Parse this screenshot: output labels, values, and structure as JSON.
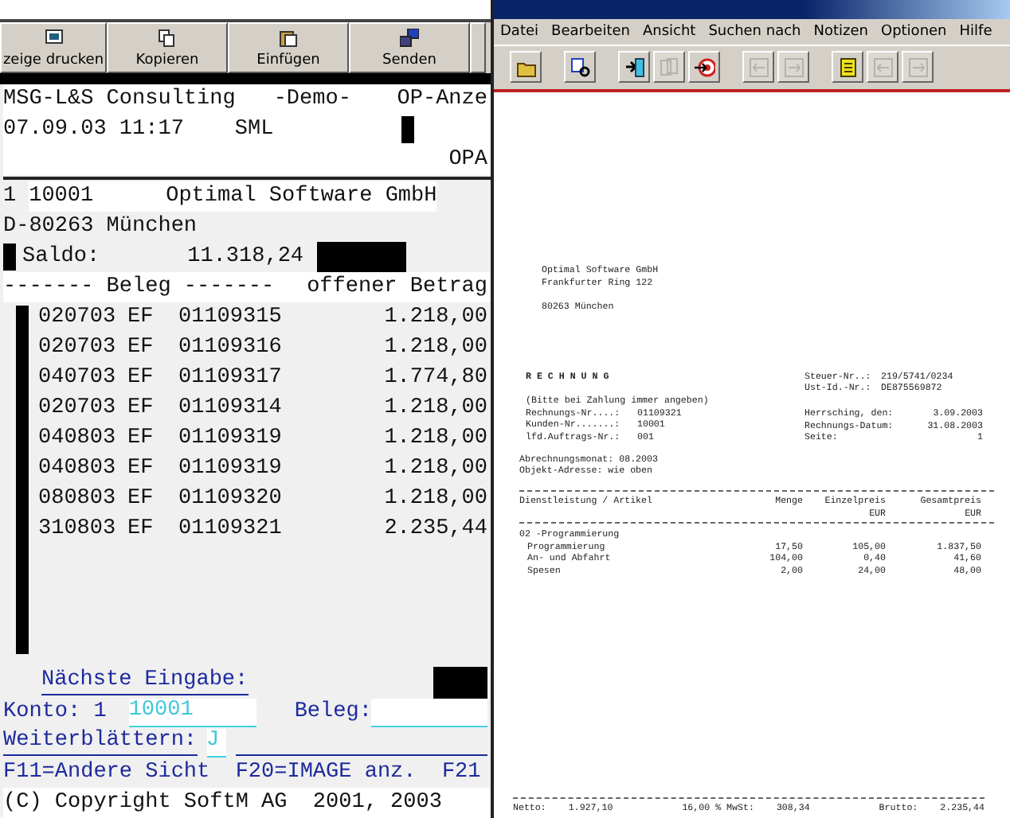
{
  "terminal_window": {
    "toolbar": [
      {
        "label": "zeige drucken",
        "kind": "print"
      },
      {
        "label": "Kopieren",
        "kind": "copy"
      },
      {
        "label": "Einfügen",
        "kind": "paste"
      },
      {
        "label": "Senden",
        "kind": "send"
      }
    ],
    "company": "MSG-L&S Consulting",
    "mode": "-Demo-",
    "screen_title": "OP-Anze",
    "datetime": "07.09.03 11:17",
    "user": "SML",
    "program": "OPA",
    "account_line": {
      "number": "1",
      "account": "10001",
      "name": "Optimal Software GmbH"
    },
    "city": "D-80263 München",
    "saldo_label": "Saldo:",
    "saldo": "11.318,24",
    "list_header": {
      "beleg": "------- Beleg -------",
      "betrag": "offener Betrag"
    },
    "rows": [
      {
        "date": "020703",
        "type": "EF",
        "beleg": "01109315",
        "amount": "1.218,00"
      },
      {
        "date": "020703",
        "type": "EF",
        "beleg": "01109316",
        "amount": "1.218,00"
      },
      {
        "date": "040703",
        "type": "EF",
        "beleg": "01109317",
        "amount": "1.774,80"
      },
      {
        "date": "020703",
        "type": "EF",
        "beleg": "01109314",
        "amount": "1.218,00"
      },
      {
        "date": "040803",
        "type": "EF",
        "beleg": "01109319",
        "amount": "1.218,00"
      },
      {
        "date": "040803",
        "type": "EF",
        "beleg": "01109319",
        "amount": "1.218,00"
      },
      {
        "date": "080803",
        "type": "EF",
        "beleg": "01109320",
        "amount": "1.218,00"
      },
      {
        "date": "310803",
        "type": "EF",
        "beleg": "01109321",
        "amount": "2.235,44"
      }
    ],
    "next_input": "Nächste Eingabe:",
    "konto_label": "Konto: 1",
    "konto_value": "10001",
    "beleg_label": "Beleg:",
    "page_label": "Weiterblättern:",
    "page_value": "J",
    "function_keys": "F11=Andere Sicht  F20=IMAGE anz.  F21",
    "copyright": "(C) Copyright SoftM AG  2001, 2003"
  },
  "viewer_window": {
    "menu": [
      "Datei",
      "Bearbeiten",
      "Ansicht",
      "Suchen nach",
      "Notizen",
      "Optionen",
      "Hilfe"
    ],
    "toolbar": [
      [
        {
          "kind": "open",
          "disabled": false
        }
      ],
      [
        {
          "kind": "find",
          "disabled": false
        }
      ],
      [
        {
          "kind": "import",
          "disabled": false
        },
        {
          "kind": "pages",
          "disabled": true
        },
        {
          "kind": "target",
          "disabled": false
        }
      ],
      [
        {
          "kind": "prev",
          "disabled": true
        },
        {
          "kind": "next",
          "disabled": true
        }
      ],
      [
        {
          "kind": "note",
          "disabled": false
        },
        {
          "kind": "prev",
          "disabled": true
        },
        {
          "kind": "next",
          "disabled": true
        }
      ]
    ],
    "document": {
      "address": [
        "Optimal Software GmbH",
        "Frankfurter Ring 122"
      ],
      "city": "80263 München",
      "title": "R E C H N U N G",
      "tax": [
        {
          "label": "Steuer-Nr..:",
          "value": "219/5741/0234"
        },
        {
          "label": "Ust-Id.-Nr.:",
          "value": "DE875569872"
        }
      ],
      "note": "(Bitte bei Zahlung immer angeben)",
      "refs": [
        {
          "label": "Rechnungs-Nr....:",
          "value": "01109321"
        },
        {
          "label": "Kunden-Nr.......:",
          "value": "10001"
        },
        {
          "label": "lfd.Auftrags-Nr.:",
          "value": "001"
        }
      ],
      "dates": [
        {
          "label": "Herrsching, den:",
          "value": "3.09.2003"
        },
        {
          "label": "Rechnungs-Datum:",
          "value": "31.08.2003"
        },
        {
          "label": "Seite:",
          "value": "1"
        }
      ],
      "period": "Abrechnungsmonat: 08.2003",
      "object": "Objekt-Adresse: wie oben",
      "columns": [
        {
          "label": "Dienstleistung / Artikel"
        },
        {
          "label": "Menge"
        },
        {
          "label": "Einzelpreis",
          "unit": "EUR"
        },
        {
          "label": "Gesamtpreis",
          "unit": "EUR"
        }
      ],
      "group": "02 -Programmierung",
      "items": [
        {
          "name": "Programmierung",
          "quantity": "17,50",
          "unit_price": "105,00",
          "total": "1.837,50"
        },
        {
          "name": "An- und Abfahrt",
          "quantity": "104,00",
          "unit_price": "0,40",
          "total": "41,60"
        },
        {
          "name": "Spesen",
          "quantity": "2,00",
          "unit_price": "24,00",
          "total": "48,00"
        }
      ],
      "totals": [
        {
          "label": "Netto:",
          "value": "1.927,10"
        },
        {
          "label": "16,00 % MwSt:",
          "value": "308,34"
        },
        {
          "label": "Brutto:",
          "value": "2.235,44"
        }
      ]
    }
  }
}
